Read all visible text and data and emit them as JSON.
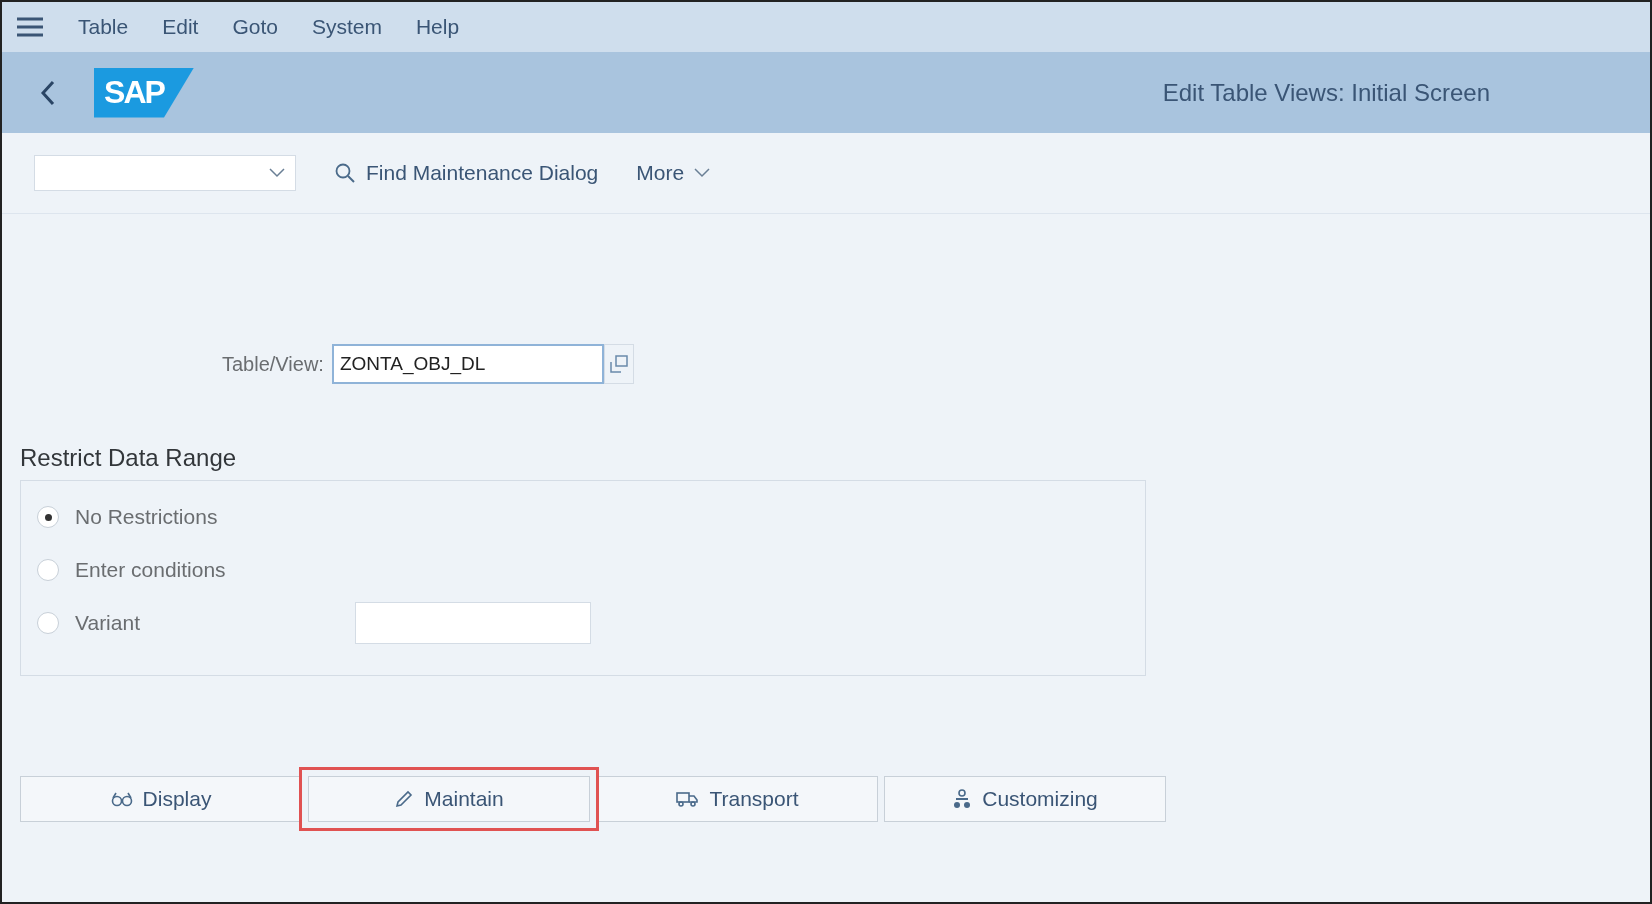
{
  "menu_bar": {
    "items": [
      "Table",
      "Edit",
      "Goto",
      "System",
      "Help"
    ]
  },
  "header": {
    "logo": "SAP",
    "title": "Edit Table Views: Initial Screen"
  },
  "toolbar": {
    "actions": [
      {
        "kind": "search",
        "label": "Find Maintenance Dialog"
      },
      {
        "kind": "more",
        "label": "More"
      }
    ]
  },
  "table_view": {
    "label": "Table/View:",
    "value": "ZONTA_OBJ_DL"
  },
  "restrict": {
    "title": "Restrict Data Range",
    "options": [
      {
        "label": "No Restrictions",
        "selected": true,
        "kind": "plain"
      },
      {
        "label": "Enter conditions",
        "selected": false,
        "kind": "plain"
      },
      {
        "label": "Variant",
        "selected": false,
        "kind": "field"
      }
    ]
  },
  "buttons": [
    {
      "kind": "display",
      "label": "Display",
      "highlighted": false
    },
    {
      "kind": "maintain",
      "label": "Maintain",
      "highlighted": true
    },
    {
      "kind": "transport",
      "label": "Transport",
      "highlighted": false
    },
    {
      "kind": "customizing",
      "label": "Customizing",
      "highlighted": false
    }
  ]
}
